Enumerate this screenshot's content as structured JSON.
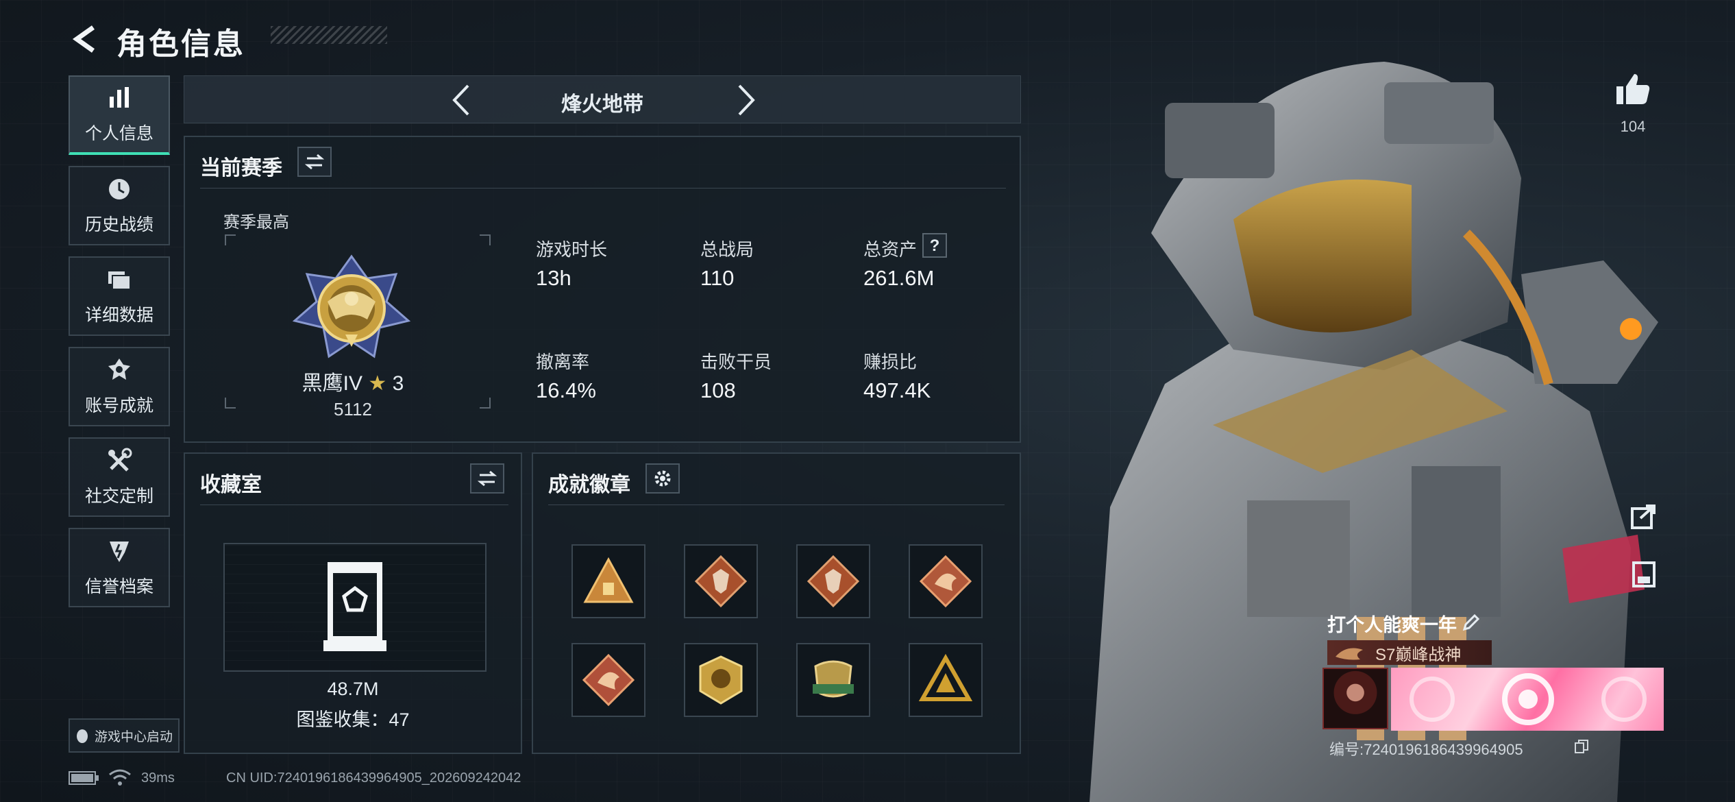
{
  "header": {
    "title": "角色信息"
  },
  "sidebar": {
    "items": [
      {
        "label": "个人信息",
        "icon": "bar-chart-icon",
        "active": true
      },
      {
        "label": "历史战绩",
        "icon": "clock-icon"
      },
      {
        "label": "详细数据",
        "icon": "folder-icon"
      },
      {
        "label": "账号成就",
        "icon": "achievement-icon"
      },
      {
        "label": "社交定制",
        "icon": "tools-icon"
      },
      {
        "label": "信誉档案",
        "icon": "shield-icon"
      }
    ],
    "launch_label": "游戏中心启动"
  },
  "mode": {
    "label": "烽火地带"
  },
  "season": {
    "title": "当前赛季",
    "best_label": "赛季最高",
    "rank_name": "黑鹰IV",
    "rank_stars": "3",
    "rank_points": "5112",
    "stats": [
      {
        "label": "游戏时长",
        "value": "13h"
      },
      {
        "label": "总战局",
        "value": "110"
      },
      {
        "label": "总资产",
        "value": "261.6M",
        "help": "?"
      },
      {
        "label": "撤离率",
        "value": "16.4%"
      },
      {
        "label": "击败干员",
        "value": "108"
      },
      {
        "label": "赚损比",
        "value": "497.4K"
      }
    ]
  },
  "collection": {
    "title": "收藏室",
    "value": "48.7M",
    "catalog_label": "图鉴收集：47"
  },
  "badges": {
    "title": "成就徽章",
    "items": [
      {
        "icon": "pyramid-badge-icon",
        "color": "#c9873a"
      },
      {
        "icon": "wolf-badge-icon",
        "color": "#a8502c"
      },
      {
        "icon": "wolf-badge-icon",
        "color": "#a8502c"
      },
      {
        "icon": "dragon-badge-icon",
        "color": "#b0583a"
      },
      {
        "icon": "dragon-badge-icon",
        "color": "#b0503a"
      },
      {
        "icon": "gold-emblem-badge-icon",
        "color": "#c8a040"
      },
      {
        "icon": "green-banner-badge-icon",
        "color": "#3a7a4a"
      },
      {
        "icon": "triangle-badge-icon",
        "color": "#d0a030"
      }
    ]
  },
  "profile": {
    "likes": "104",
    "nickname": "打个人能爽一年",
    "title_badge": "S7巅峰战神",
    "uid_label": "编号:7240196186439964905"
  },
  "footer": {
    "ping": "39ms",
    "uid": "CN UID:7240196186439964905_202609242042"
  },
  "colors": {
    "accent": "#3fe0b5",
    "gold": "#c8a040",
    "panel_border": "#34414b"
  }
}
